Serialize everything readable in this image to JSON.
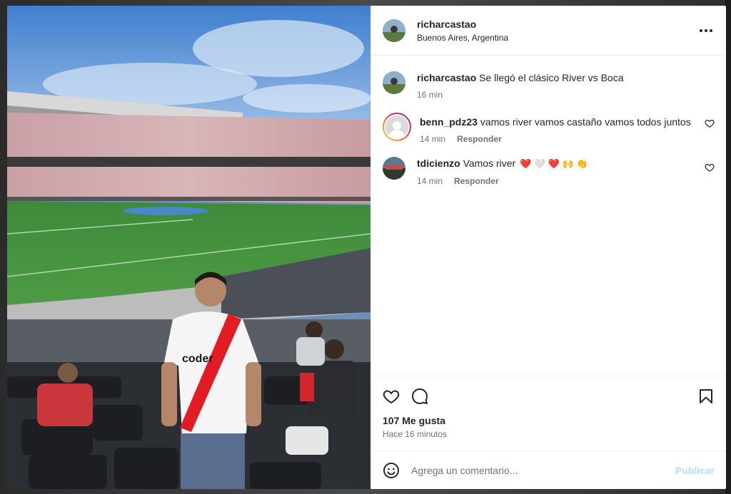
{
  "post": {
    "username": "richarcastao",
    "location": "Buenos Aires, Argentina",
    "caption_user": "richarcastao",
    "caption_text": "Se llegó el clásico River vs Boca",
    "caption_time": "16 min"
  },
  "comments": [
    {
      "user": "benn_pdz23",
      "text": "vamos river vamos castaño vamos todos juntos",
      "time": "14 min",
      "reply_label": "Responder",
      "emojis": ""
    },
    {
      "user": "tdicienzo",
      "text": "Vamos river",
      "time": "14 min",
      "reply_label": "Responder",
      "emojis": "❤️ 🤍 ❤️ 🙌 👏"
    }
  ],
  "actions": {
    "likes": "107 Me gusta",
    "posted_ago": "Hace 16 minutos"
  },
  "add_comment": {
    "placeholder": "Agrega un comentario...",
    "publish_label": "Publicar"
  },
  "colors": {
    "text": "#262626",
    "muted": "#737373",
    "publish_disabled": "#b2dffc",
    "river_red": "#e31b23"
  },
  "icons": [
    "more-icon",
    "heart-icon",
    "comment-icon",
    "bookmark-icon",
    "smiley-icon",
    "heart-small-icon"
  ]
}
